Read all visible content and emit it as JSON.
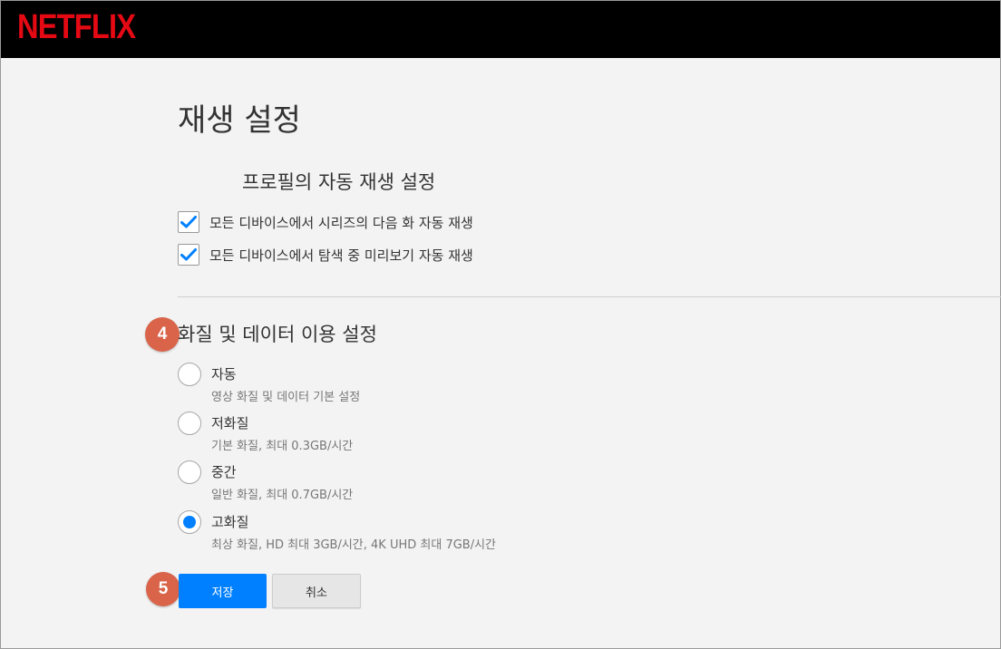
{
  "header": {
    "logo": "NETFLIX",
    "logo_color": "#e50914"
  },
  "page": {
    "title": "재생 설정"
  },
  "autoplay": {
    "title": "프로필의 자동 재생 설정",
    "options": [
      {
        "label": "모든 디바이스에서 시리즈의 다음 화 자동 재생",
        "checked": true
      },
      {
        "label": "모든 디바이스에서 탐색 중 미리보기 자동 재생",
        "checked": true
      }
    ]
  },
  "quality": {
    "title": "화질 및 데이터 이용 설정",
    "options": [
      {
        "label": "자동",
        "description": "영상 화질 및 데이터 기본 설정",
        "selected": false
      },
      {
        "label": "저화질",
        "description": "기본 화질, 최대 0.3GB/시간",
        "selected": false
      },
      {
        "label": "중간",
        "description": "일반 화질, 최대 0.7GB/시간",
        "selected": false
      },
      {
        "label": "고화질",
        "description": "최상 화질, HD 최대 3GB/시간, 4K UHD 최대 7GB/시간",
        "selected": true
      }
    ]
  },
  "steps": {
    "quality_step": "4",
    "save_step": "5"
  },
  "actions": {
    "save_label": "저장",
    "cancel_label": "취소"
  },
  "colors": {
    "accent": "#0080ff",
    "step_badge": "#d9644a"
  }
}
